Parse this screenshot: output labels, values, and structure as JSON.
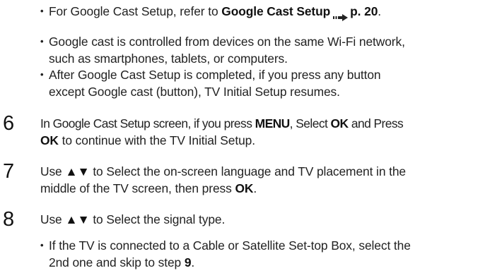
{
  "bullets_top": [
    {
      "pre": "For Google Cast Setup, refer to ",
      "bold": "Google Cast Setup",
      "page": "p. 20",
      "post": "."
    },
    {
      "line1": "Google cast is controlled from devices on the same Wi-Fi network,",
      "line2": "such as smartphones, tablets, or computers."
    },
    {
      "line1": "After Google Cast Setup is completed, if you press any button",
      "line2": "except Google cast (button), TV Initial Setup resumes."
    }
  ],
  "step6": {
    "number": "6",
    "l1_a": "In Google Cast Setup screen, if you press ",
    "l1_menu": "MENU",
    "l1_b": ", Select ",
    "l1_ok": "OK",
    "l1_c": " and Press",
    "l2_ok": "OK",
    "l2_rest": " to continue with the TV Initial Setup."
  },
  "step7": {
    "number": "7",
    "l1_a": "Use ",
    "arrows": "▲▼",
    "l1_b": " to Select the on-screen language and TV placement in the",
    "l2_a": "middle of the TV screen, then press ",
    "l2_ok": "OK",
    "l2_end": "."
  },
  "step8": {
    "number": "8",
    "l1_a": "Use ",
    "arrows": "▲▼",
    "l1_b": " to Select the signal type.",
    "bullet_l1": "If the TV is connected to a Cable or Satellite Set-top Box, select the",
    "bullet_l2_a": "2nd one and skip to step ",
    "bullet_l2_step": "9",
    "bullet_l2_end": "."
  },
  "dot": "•"
}
